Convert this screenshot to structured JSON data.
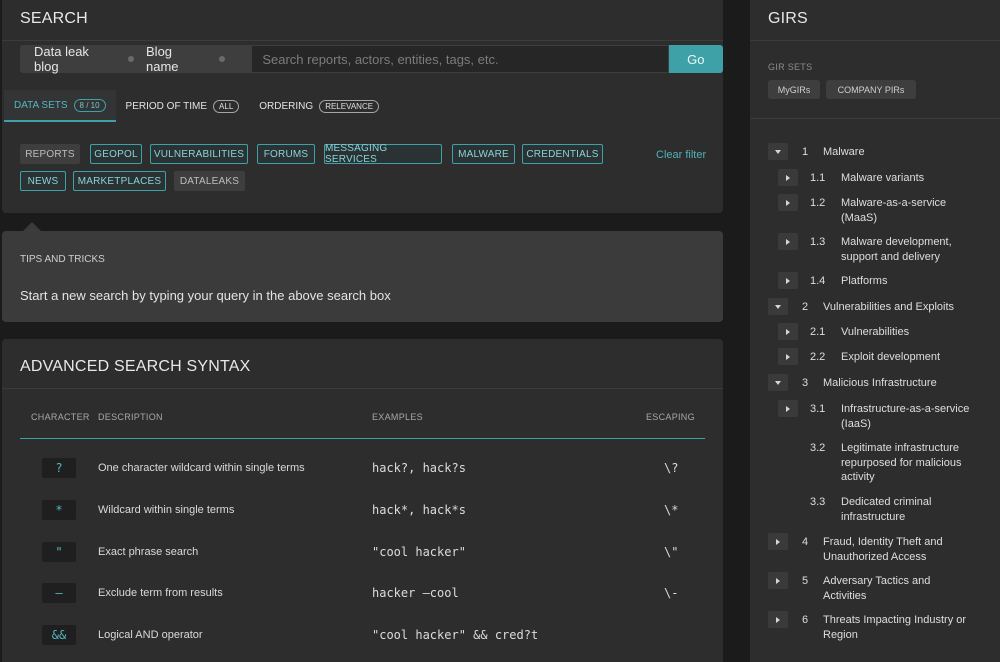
{
  "search": {
    "title": "SEARCH",
    "breadcrumb": [
      "Data leak blog",
      "Blog name"
    ],
    "placeholder": "Search reports, actors, entities, tags, etc.",
    "go_label": "Go",
    "tabs": [
      {
        "label": "DATA SETS",
        "badge": "8 / 10"
      },
      {
        "label": "PERIOD OF TIME",
        "badge": "ALL"
      },
      {
        "label": "ORDERING",
        "badge": "RELEVANCE"
      }
    ],
    "filters_row1": [
      "REPORTS",
      "GEOPOL",
      "VULNERABILITIES",
      "FORUMS",
      "MESSAGING SERVICES",
      "MALWARE",
      "CREDENTIALS"
    ],
    "filters_row2": [
      "NEWS",
      "MARKETPLACES",
      "DATALEAKS"
    ],
    "clear_filter": "Clear filter"
  },
  "tips": {
    "label": "TIPS AND TRICKS",
    "text": "Start a new search by typing your query in the above search box"
  },
  "advanced": {
    "title": "ADVANCED SEARCH SYNTAX",
    "columns": [
      "CHARACTER",
      "DESCRIPTION",
      "EXAMPLES",
      "ESCAPING"
    ],
    "rows": [
      {
        "char": "?",
        "desc": "One character wildcard within single terms",
        "example": "hack?, hack?s",
        "escape": "\\?"
      },
      {
        "char": "*",
        "desc": "Wildcard within single terms",
        "example": "hack*, hack*s",
        "escape": "\\*"
      },
      {
        "char": "\"",
        "desc": "Exact phrase search",
        "example": "\"cool hacker\"",
        "escape": "\\\""
      },
      {
        "char": "–",
        "desc": "Exclude term from results",
        "example": "hacker –cool",
        "escape": "\\-"
      },
      {
        "char": "&&",
        "desc": "Logical AND operator",
        "example": "\"cool hacker\" && cred?t",
        "escape": ""
      }
    ]
  },
  "girs": {
    "title": "GIRS",
    "sets_label": "GIR SETS",
    "sets": [
      "MyGIRs",
      "COMPANY PIRs"
    ],
    "tree": [
      {
        "num": "1",
        "label": "Malware",
        "expanded": true
      },
      {
        "num": "1.1",
        "label": "Malware variants"
      },
      {
        "num": "1.2",
        "label": "Malware-as-a-service (MaaS)"
      },
      {
        "num": "1.3",
        "label": "Malware development, support and delivery"
      },
      {
        "num": "1.4",
        "label": "Platforms"
      },
      {
        "num": "2",
        "label": "Vulnerabilities and Exploits",
        "expanded": true
      },
      {
        "num": "2.1",
        "label": "Vulnerabilities"
      },
      {
        "num": "2.2",
        "label": "Exploit development"
      },
      {
        "num": "3",
        "label": "Malicious Infrastructure",
        "expanded": true
      },
      {
        "num": "3.1",
        "label": "Infrastructure-as-a-service (IaaS)"
      },
      {
        "num": "3.2",
        "label": "Legitimate infrastructure repurposed for malicious activity"
      },
      {
        "num": "3.3",
        "label": "Dedicated criminal infrastructure"
      },
      {
        "num": "4",
        "label": "Fraud, Identity Theft and Unauthorized Access"
      },
      {
        "num": "5",
        "label": "Adversary Tactics and Activities"
      },
      {
        "num": "6",
        "label": "Threats Impacting Industry or Region"
      }
    ]
  }
}
